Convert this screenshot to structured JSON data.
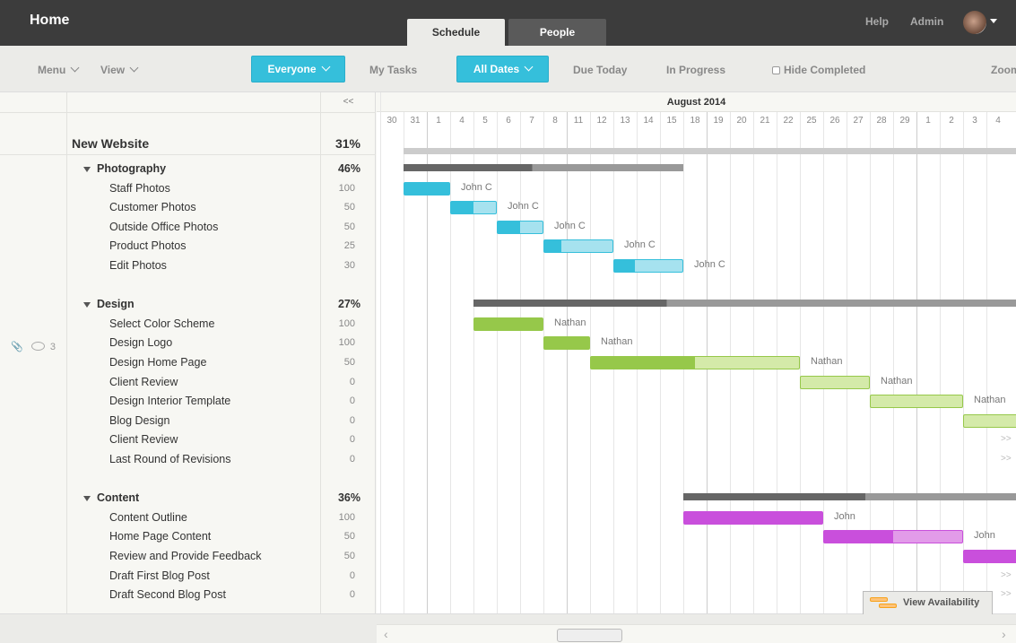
{
  "header": {
    "title": "Home",
    "tabs": [
      {
        "label": "Schedule",
        "active": true
      },
      {
        "label": "People",
        "active": false
      }
    ],
    "help": "Help",
    "admin": "Admin",
    "avatar": "user-avatar"
  },
  "toolbar": {
    "menu": "Menu",
    "view": "View",
    "everyone": "Everyone",
    "my_tasks": "My Tasks",
    "all_dates": "All Dates",
    "due_today": "Due Today",
    "in_progress": "In Progress",
    "hide_completed": "Hide Completed",
    "hide_completed_checked": false,
    "zoom": "Zoom",
    "accent": "#35bfdb"
  },
  "collapse": "<<",
  "project": {
    "name": "New Website",
    "pct": "31%",
    "start": "2014-07-31",
    "end": "2014-09-05"
  },
  "meta": {
    "comments": "3"
  },
  "timeline": {
    "month": "August 2014",
    "days": [
      "2014-07-30",
      "2014-07-31",
      "2014-08-01",
      "2014-08-04",
      "2014-08-05",
      "2014-08-06",
      "2014-08-07",
      "2014-08-08",
      "2014-08-11",
      "2014-08-12",
      "2014-08-13",
      "2014-08-14",
      "2014-08-15",
      "2014-08-18",
      "2014-08-19",
      "2014-08-20",
      "2014-08-21",
      "2014-08-22",
      "2014-08-25",
      "2014-08-26",
      "2014-08-27",
      "2014-08-28",
      "2014-08-29",
      "2014-09-01",
      "2014-09-02",
      "2014-09-03",
      "2014-09-04"
    ],
    "day_labels": [
      "30",
      "31",
      "1",
      "4",
      "5",
      "6",
      "7",
      "8",
      "11",
      "12",
      "13",
      "14",
      "15",
      "18",
      "19",
      "20",
      "21",
      "22",
      "25",
      "26",
      "27",
      "28",
      "29",
      "1",
      "2",
      "3",
      "4"
    ]
  },
  "groups": [
    {
      "name": "Photography",
      "pct": "46%",
      "progress": 0.46,
      "start": "2014-07-31",
      "end": "2014-08-15",
      "color": "#35bfdb",
      "light": "#a6e2ef",
      "tasks": [
        {
          "name": "Staff Photos",
          "pct": "100",
          "progress": 1,
          "start": "2014-07-31",
          "end": "2014-08-01",
          "who": "John C"
        },
        {
          "name": "Customer Photos",
          "pct": "50",
          "progress": 0.5,
          "start": "2014-08-04",
          "end": "2014-08-05",
          "who": "John C"
        },
        {
          "name": "Outside Office Photos",
          "pct": "50",
          "progress": 0.5,
          "start": "2014-08-06",
          "end": "2014-08-07",
          "who": "John C"
        },
        {
          "name": "Product Photos",
          "pct": "25",
          "progress": 0.25,
          "start": "2014-08-08",
          "end": "2014-08-12",
          "who": "John C"
        },
        {
          "name": "Edit Photos",
          "pct": "30",
          "progress": 0.3,
          "start": "2014-08-13",
          "end": "2014-08-15",
          "who": "John C"
        }
      ]
    },
    {
      "name": "Design",
      "pct": "27%",
      "progress": 0.27,
      "start": "2014-08-05",
      "end": "2014-09-12",
      "color": "#96c84a",
      "light": "#d4eaa9",
      "tasks": [
        {
          "name": "Select Color Scheme",
          "pct": "100",
          "progress": 1,
          "start": "2014-08-05",
          "end": "2014-08-07",
          "who": "Nathan"
        },
        {
          "name": "Design Logo",
          "pct": "100",
          "progress": 1,
          "start": "2014-08-08",
          "end": "2014-08-11",
          "who": "Nathan"
        },
        {
          "name": "Design Home Page",
          "pct": "50",
          "progress": 0.5,
          "start": "2014-08-12",
          "end": "2014-08-22",
          "who": "Nathan"
        },
        {
          "name": "Client Review",
          "pct": "0",
          "progress": 0,
          "start": "2014-08-25",
          "end": "2014-08-27",
          "who": "Nathan"
        },
        {
          "name": "Design Interior Template",
          "pct": "0",
          "progress": 0,
          "start": "2014-08-28",
          "end": "2014-09-02",
          "who": "Nathan"
        },
        {
          "name": "Blog Design",
          "pct": "0",
          "progress": 0,
          "start": "2014-09-03",
          "end": "2014-09-12",
          "who": ""
        },
        {
          "name": "Client Review",
          "pct": "0",
          "progress": 0,
          "offscreen": true,
          "more": ">>"
        },
        {
          "name": "Last Round of Revisions",
          "pct": "0",
          "progress": 0,
          "offscreen": true,
          "more": ">>"
        }
      ]
    },
    {
      "name": "Content",
      "pct": "36%",
      "progress": 0.36,
      "start": "2014-08-18",
      "end": "2014-09-12",
      "color": "#c94fdc",
      "light": "#e29be9",
      "tasks": [
        {
          "name": "Content Outline",
          "pct": "100",
          "progress": 1,
          "start": "2014-08-18",
          "end": "2014-08-25",
          "who": "John"
        },
        {
          "name": "Home Page Content",
          "pct": "50",
          "progress": 0.5,
          "start": "2014-08-26",
          "end": "2014-09-02",
          "who": "John"
        },
        {
          "name": "Review and Provide Feedback",
          "pct": "50",
          "progress": 1,
          "start": "2014-09-03",
          "end": "2014-09-12",
          "who": ""
        },
        {
          "name": "Draft First Blog Post",
          "pct": "0",
          "progress": 0,
          "offscreen": true,
          "more": ">>"
        },
        {
          "name": "Draft Second Blog Post",
          "pct": "0",
          "progress": 0,
          "offscreen": true,
          "more": ">>"
        }
      ]
    }
  ],
  "view_availability": "View Availability"
}
